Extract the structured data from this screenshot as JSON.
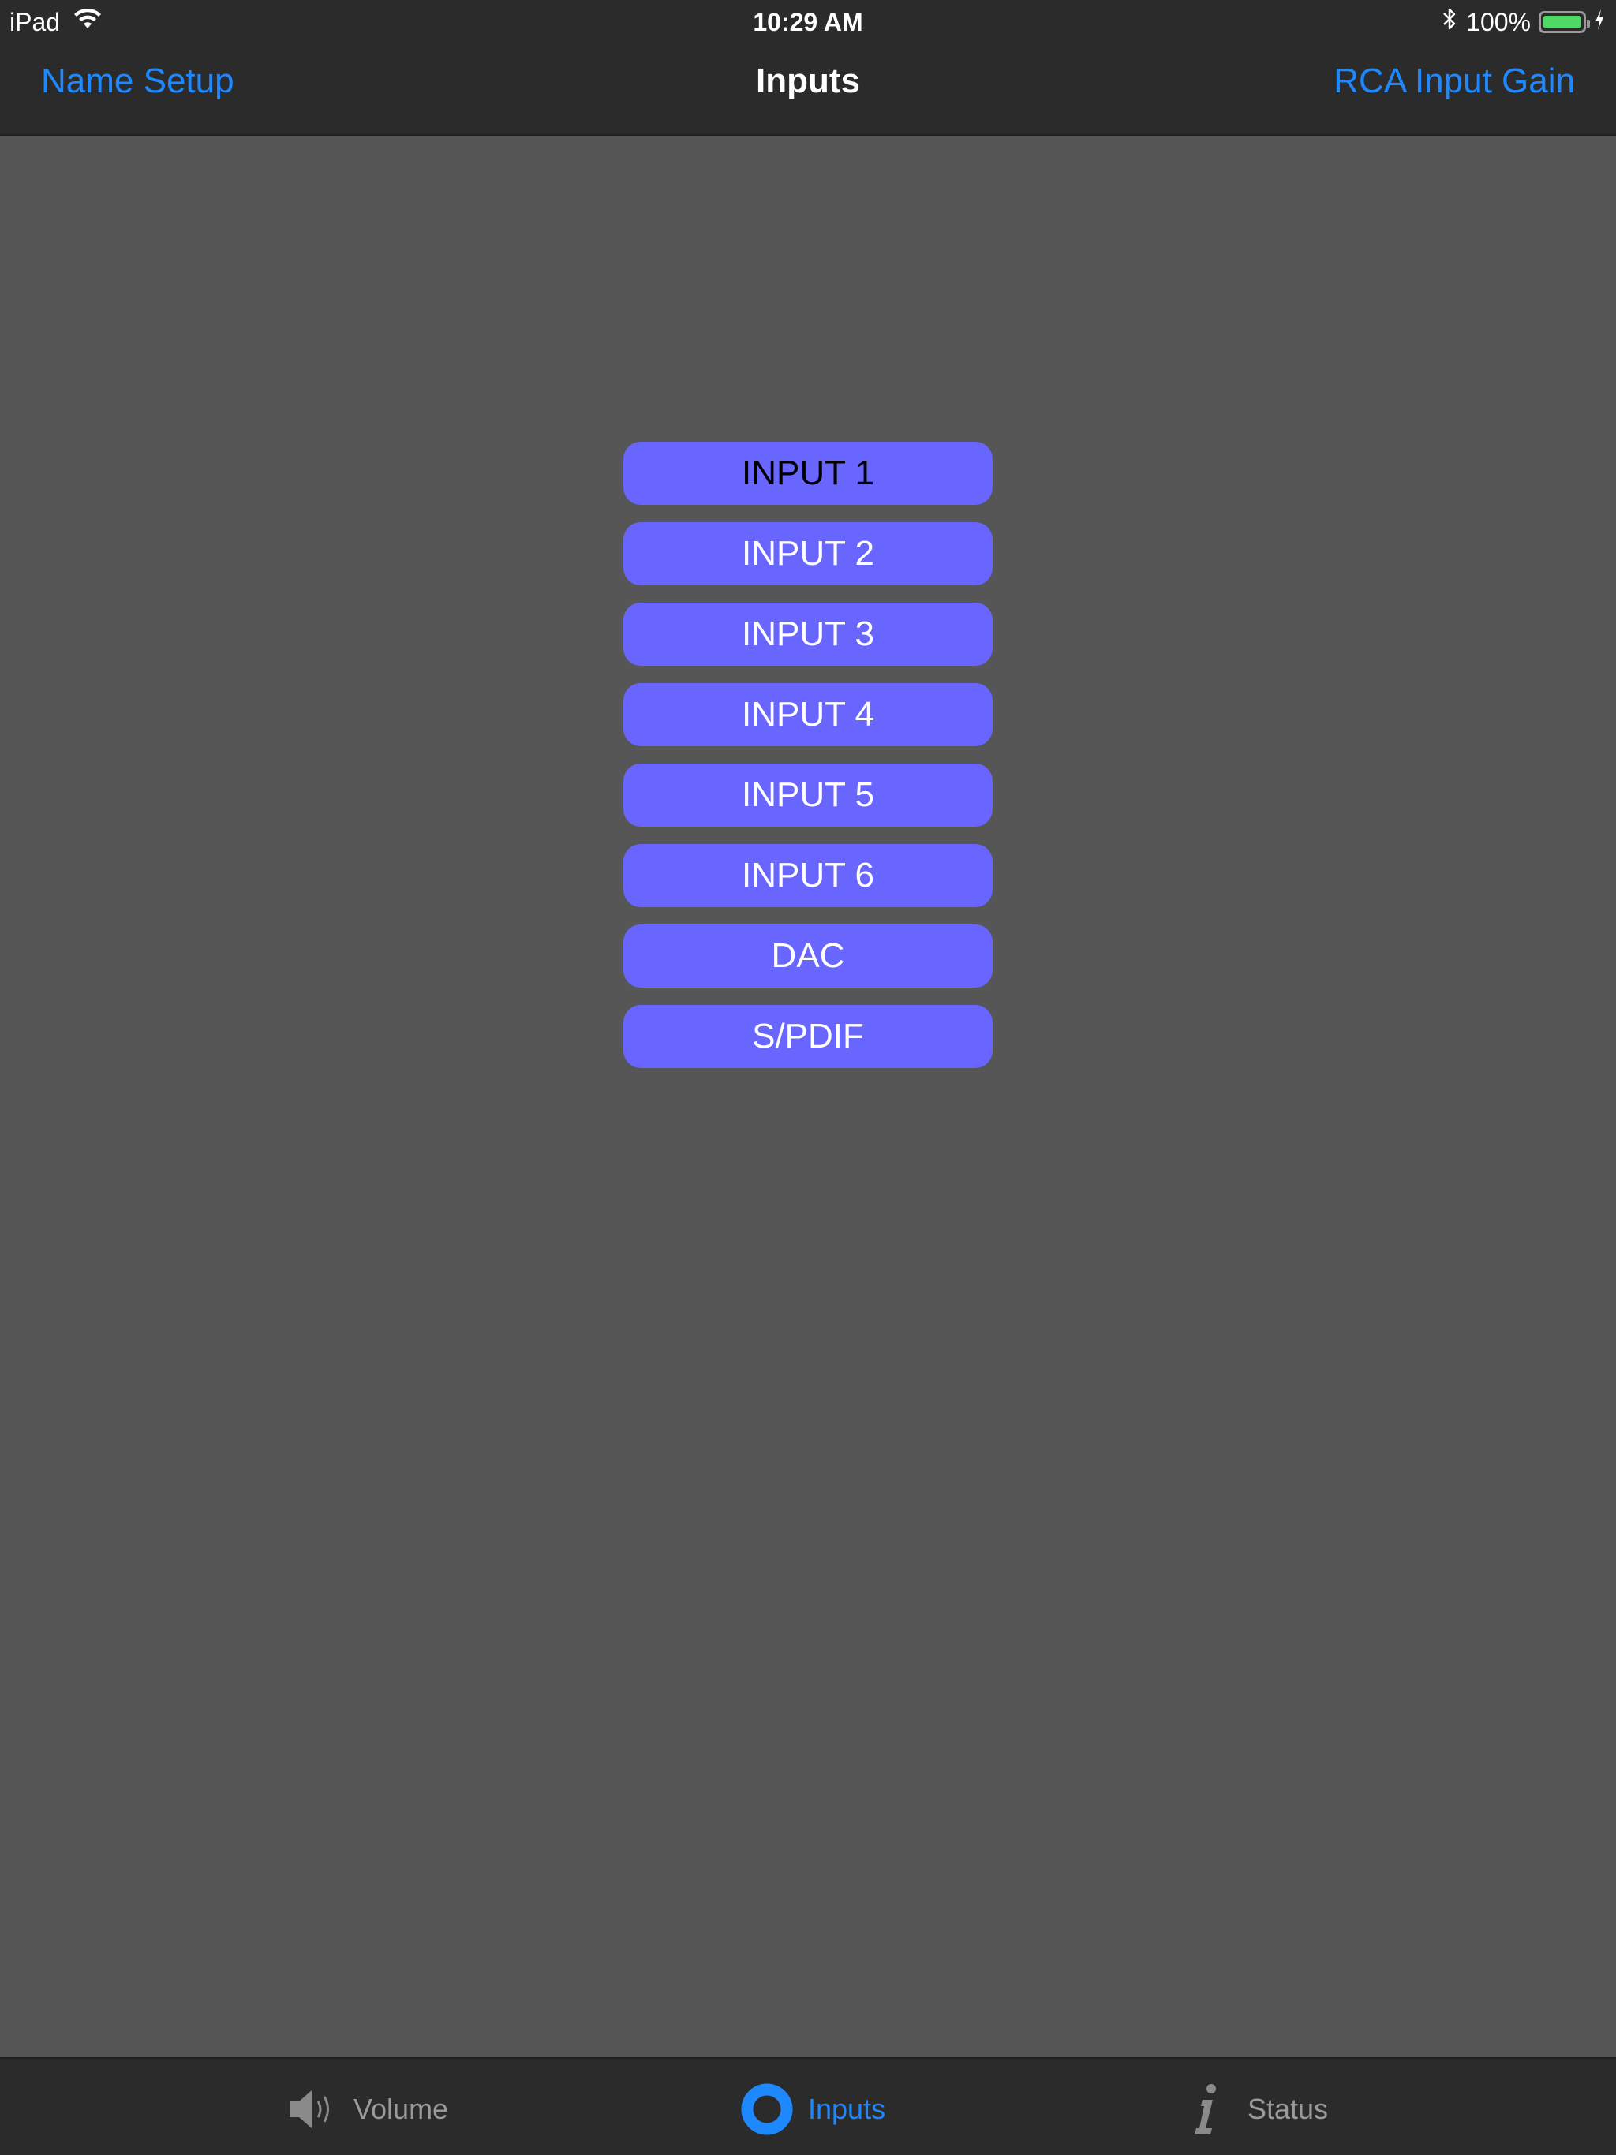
{
  "status_bar": {
    "device": "iPad",
    "time": "10:29 AM",
    "battery_percent": "100%",
    "battery_level": 1.0,
    "icons": [
      "wifi-icon",
      "bluetooth-icon",
      "battery-icon",
      "charging-bolt-icon"
    ]
  },
  "nav": {
    "left_label": "Name Setup",
    "title": "Inputs",
    "right_label": "RCA Input Gain",
    "accent_color": "#1e88ff"
  },
  "inputs": {
    "button_color": "#6966ff",
    "selected_index": 0,
    "items": [
      {
        "label": "INPUT 1"
      },
      {
        "label": "INPUT 2"
      },
      {
        "label": "INPUT 3"
      },
      {
        "label": "INPUT 4"
      },
      {
        "label": "INPUT 5"
      },
      {
        "label": "INPUT 6"
      },
      {
        "label": "DAC"
      },
      {
        "label": "S/PDIF"
      }
    ]
  },
  "tab_bar": {
    "active": "Inputs",
    "tabs": [
      {
        "label": "Volume",
        "icon": "speaker-icon"
      },
      {
        "label": "Inputs",
        "icon": "ring-icon"
      },
      {
        "label": "Status",
        "icon": "info-icon"
      }
    ]
  }
}
